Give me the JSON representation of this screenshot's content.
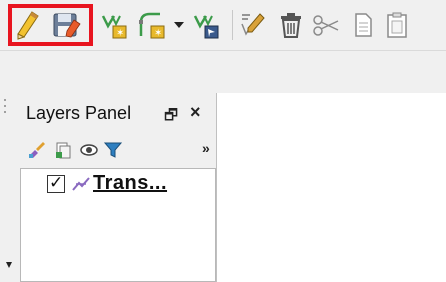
{
  "toolbar": {
    "buttons": [
      {
        "name": "toggle-editing",
        "icon": "pencil-icon",
        "highlighted": true
      },
      {
        "name": "save-edits",
        "icon": "save-edits-icon",
        "highlighted": true
      },
      {
        "name": "add-point-feature",
        "icon": "add-point-icon",
        "highlighted": false
      },
      {
        "name": "add-line-feature",
        "icon": "add-line-icon",
        "highlighted": false
      },
      {
        "name": "digitize-dropdown",
        "icon": "chevron-down-icon",
        "highlighted": false
      },
      {
        "name": "vertex-tool",
        "icon": "vertex-tool-icon",
        "highlighted": false
      },
      {
        "name": "modify-attributes",
        "icon": "modify-attributes-icon",
        "highlighted": false
      },
      {
        "name": "delete-selected",
        "icon": "trash-icon",
        "highlighted": false
      },
      {
        "name": "cut-features",
        "icon": "scissors-icon",
        "highlighted": false
      },
      {
        "name": "copy-features",
        "icon": "copy-icon",
        "highlighted": false
      },
      {
        "name": "paste-features",
        "icon": "paste-icon",
        "highlighted": false
      }
    ]
  },
  "layers_panel": {
    "title": "Layers Panel",
    "float_glyph": "🗗",
    "close_glyph": "×",
    "more_glyph": "»",
    "tools": [
      "style-brush-icon",
      "add-group-icon",
      "eye-icon",
      "filter-icon"
    ],
    "layers": [
      {
        "name": "Trans...",
        "checked": true,
        "checkmark": "✓",
        "icon": "line-layer-icon"
      }
    ]
  },
  "colors": {
    "highlight": "#e8141f",
    "background": "#f0f0f0",
    "canvas": "#ffffff"
  }
}
